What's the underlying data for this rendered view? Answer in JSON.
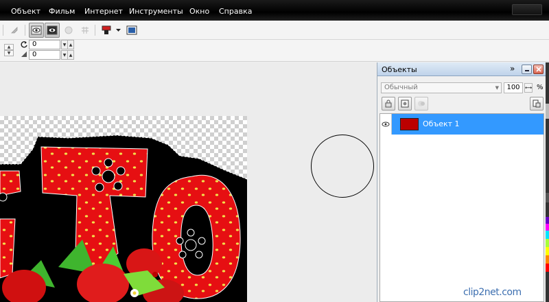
{
  "menubar": {
    "items": [
      "Объект",
      "Фильм",
      "Интернет",
      "Инструменты",
      "Окно",
      "Справка"
    ]
  },
  "toolbar": {
    "icons": [
      "pick-tool-icon",
      "eye-show-icon",
      "eye-mask-icon",
      "object-icon",
      "grid-icon",
      "color-fill-icon",
      "dropdown-arrow-icon",
      "image-icon"
    ]
  },
  "propbar": {
    "rotate_value": "0",
    "skew_value": "0"
  },
  "panel": {
    "title": "Объекты",
    "blend_mode": "Обычный",
    "opacity": "100",
    "opacity_unit": "%",
    "layers": [
      {
        "name": "Объект 1",
        "visible": true,
        "selected": true
      }
    ]
  },
  "colors": {
    "menubar_bg": "#000000",
    "selection": "#3399ff",
    "panel_title": "#c7d8ec"
  },
  "watermark": "clip2net.com"
}
